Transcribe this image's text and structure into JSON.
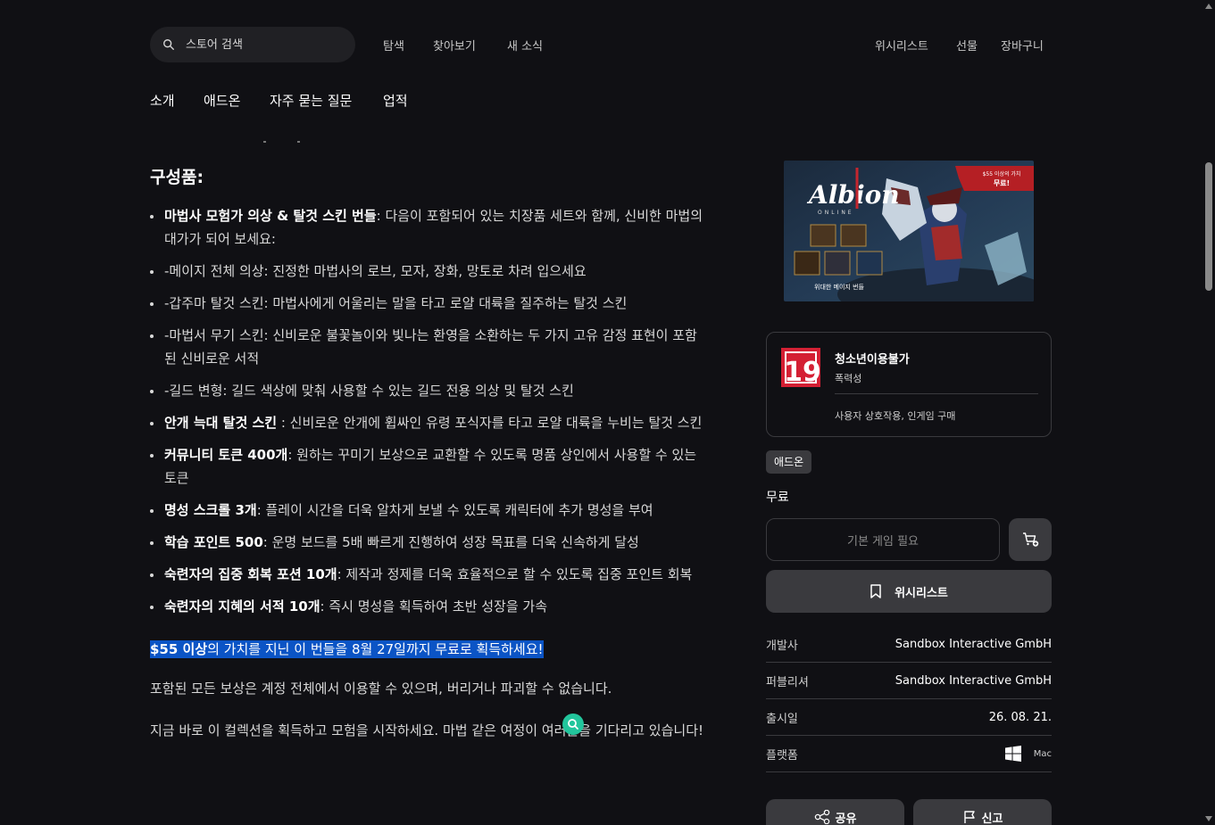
{
  "nav": {
    "search_placeholder": "스토어 검색",
    "links": [
      "탐색",
      "찾아보기",
      "새 소식"
    ],
    "right_links": [
      "위시리스트",
      "선물",
      "장바구니"
    ]
  },
  "subnav": [
    "소개",
    "애드온",
    "자주 묻는 질문",
    "업적"
  ],
  "description": {
    "heading": "구성품:",
    "items": [
      {
        "bold": "마법사 모험가 의상 & 탈것 스킨 번들",
        "text": ": 다음이 포함되어 있는 치장품 세트와 함께, 신비한 마법의 대가가 되어 보세요:"
      },
      {
        "bold": "",
        "text": "-메이지 전체 의상: 진정한 마법사의 로브, 모자, 장화, 망토로 차려 입으세요"
      },
      {
        "bold": "",
        "text": "-갑주마 탈것 스킨: 마법사에게 어울리는 말을 타고 로얄 대륙을 질주하는 탈것 스킨"
      },
      {
        "bold": "",
        "text": "-마법서 무기 스킨: 신비로운 불꽃놀이와 빛나는 환영을 소환하는 두 가지 고유 감정 표현이 포함된 신비로운 서적"
      },
      {
        "bold": "",
        "text": "-길드 변형: 길드 색상에 맞춰 사용할 수 있는 길드 전용 의상 및 탈것 스킨"
      },
      {
        "bold": "안개 늑대 탈것 스킨",
        "text": " : 신비로운 안개에 휩싸인 유령 포식자를 타고 로얄 대륙을 누비는 탈것 스킨"
      },
      {
        "bold": "커뮤니티 토큰 400개",
        "text": ": 원하는 꾸미기 보상으로 교환할 수 있도록 명품 상인에서 사용할 수 있는 토큰"
      },
      {
        "bold": "명성 스크롤 3개",
        "text": ": 플레이 시간을 더욱 알차게 보낼 수 있도록 캐릭터에 추가 명성을 부여"
      },
      {
        "bold": "학습 포인트 500",
        "text": ": 운명 보드를 5배 빠르게 진행하여 성장 목표를 더욱 신속하게 달성"
      },
      {
        "bold": "숙련자의 집중 회복 포션 10개",
        "text": ": 제작과 정제를 더욱 효율적으로 할 수 있도록 집중 포인트 회복"
      },
      {
        "bold": "숙련자의 지혜의 서적 10개",
        "text": ": 즉시 명성을 획득하여 초반 성장을 가속"
      }
    ],
    "highlight_bold": "$55 이상",
    "highlight_text": "의 가치를 지닌 이 번들을 8월 27일까지 무료로 획득하세요!",
    "para1": "포함된 모든 보상은 계정 전체에서 이용할 수 있으며, 버리거나 파괴할 수 없습니다.",
    "para2": "지금 바로 이 컬렉션을 획득하고 모험을 시작하세요. 마법 같은 여정이 여러분을 기다리고 있습니다!"
  },
  "banner": {
    "logo": "Albion",
    "logo_sub": "ONLINE",
    "ribbon_line1": "$55 이상의 가치",
    "ribbon_line2": "무료!",
    "caption": "위대한 메이지 번들"
  },
  "rating": {
    "age": "19",
    "title": "청소년이용불가",
    "descriptor": "폭력성",
    "interactive": "사용자 상호작용, 인게임 구매"
  },
  "purchase": {
    "type_badge": "애드온",
    "price": "무료",
    "base_game_button": "기본 게임 필요",
    "wishlist_button": "위시리스트"
  },
  "meta": [
    {
      "key": "개발사",
      "value": "Sandbox Interactive GmbH"
    },
    {
      "key": "퍼블리셔",
      "value": "Sandbox Interactive GmbH"
    },
    {
      "key": "출시일",
      "value": "26. 08. 21."
    },
    {
      "key": "플랫폼",
      "value": ""
    }
  ],
  "platforms": [
    "windows-icon",
    "Mac"
  ],
  "actions": {
    "share": "공유",
    "report": "신고"
  },
  "colors": {
    "background": "#101014",
    "surface": "#3a3a3e",
    "highlight": "#0b54c5",
    "accent_badge": "#22c59c"
  }
}
